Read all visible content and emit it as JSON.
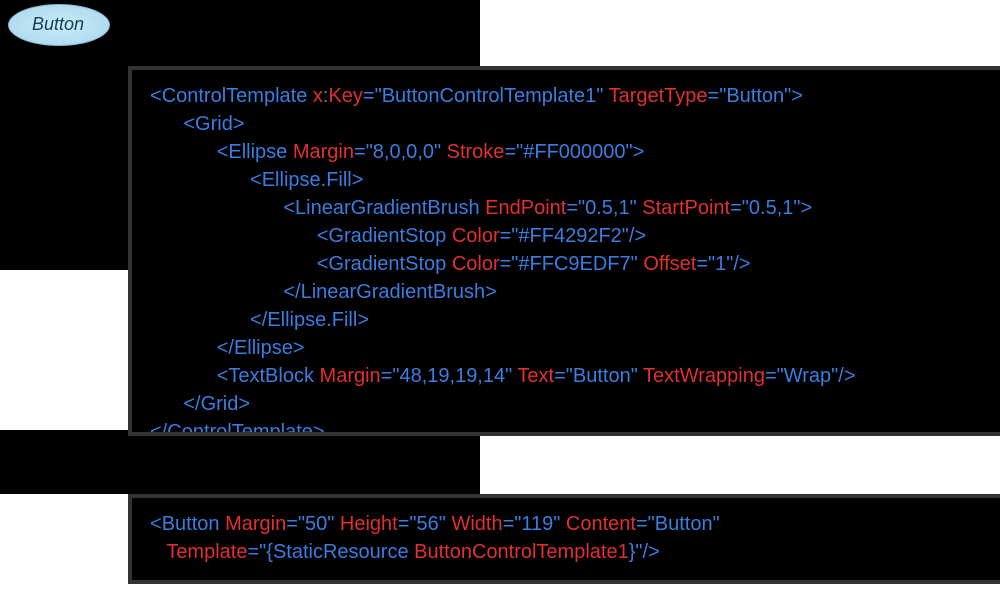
{
  "button": {
    "label": "Button"
  },
  "code1": {
    "html": "<span class='punct'>&lt;</span><span class='kw'>ControlTemplate</span> <span class='attr'>x</span><span class='punct'>:</span><span class='attr'>Key</span><span class='punct'>=</span><span class='val'>\"ButtonControlTemplate1\"</span> <span class='attr'>TargetType</span><span class='punct'>=</span><span class='val'>\"Button\"</span><span class='punct'>&gt;</span>\n      <span class='punct'>&lt;</span><span class='kw'>Grid</span><span class='punct'>&gt;</span>\n            <span class='punct'>&lt;</span><span class='kw'>Ellipse</span> <span class='attr'>Margin</span><span class='punct'>=</span><span class='val'>\"8,0,0,0\"</span> <span class='attr'>Stroke</span><span class='punct'>=</span><span class='val'>\"#FF000000\"</span><span class='punct'>&gt;</span>\n                  <span class='punct'>&lt;</span><span class='kw'>Ellipse.Fill</span><span class='punct'>&gt;</span>\n                        <span class='punct'>&lt;</span><span class='kw'>LinearGradientBrush</span> <span class='attr'>EndPoint</span><span class='punct'>=</span><span class='val'>\"0.5,1\"</span> <span class='attr'>StartPoint</span><span class='punct'>=</span><span class='val'>\"0.5,1\"</span><span class='punct'>&gt;</span>\n                              <span class='punct'>&lt;</span><span class='kw'>GradientStop</span> <span class='attr'>Color</span><span class='punct'>=</span><span class='val'>\"#FF4292F2\"</span><span class='punct'>/&gt;</span>\n                              <span class='punct'>&lt;</span><span class='kw'>GradientStop</span> <span class='attr'>Color</span><span class='punct'>=</span><span class='val'>\"#FFC9EDF7\"</span> <span class='attr'>Offset</span><span class='punct'>=</span><span class='val'>\"1\"</span><span class='punct'>/&gt;</span>\n                        <span class='punct'>&lt;/</span><span class='kw'>LinearGradientBrush</span><span class='punct'>&gt;</span>\n                  <span class='punct'>&lt;/</span><span class='kw'>Ellipse.Fill</span><span class='punct'>&gt;</span>\n            <span class='punct'>&lt;/</span><span class='kw'>Ellipse</span><span class='punct'>&gt;</span>\n            <span class='punct'>&lt;</span><span class='kw'>TextBlock</span> <span class='attr'>Margin</span><span class='punct'>=</span><span class='val'>\"48,19,19,14\"</span> <span class='attr'>Text</span><span class='punct'>=</span><span class='val'>\"Button\"</span> <span class='attr'>TextWrapping</span><span class='punct'>=</span><span class='val'>\"Wrap\"</span><span class='punct'>/&gt;</span>\n      <span class='punct'>&lt;/</span><span class='kw'>Grid</span><span class='punct'>&gt;</span>\n<span class='punct'>&lt;/</span><span class='kw'>ControlTemplate</span><span class='punct'>&gt;</span>"
  },
  "code2": {
    "html": "<span class='punct'>&lt;</span><span class='kw'>Button</span> <span class='attr'>Margin</span><span class='punct'>=</span><span class='val'>\"50\"</span> <span class='attr'>Height</span><span class='punct'>=</span><span class='val'>\"56\"</span> <span class='attr'>Width</span><span class='punct'>=</span><span class='val'>\"119\"</span> <span class='attr'>Content</span><span class='punct'>=</span><span class='val'>\"Button\"</span>\n   <span class='attr'>Template</span><span class='punct'>=</span><span class='val'>\"</span><span class='punct'>{</span><span class='kw'>StaticResource</span> <span class='attr'>ButtonControlTemplate1</span><span class='punct'>}</span><span class='val'>\"</span><span class='punct'>/&gt;</span>"
  }
}
